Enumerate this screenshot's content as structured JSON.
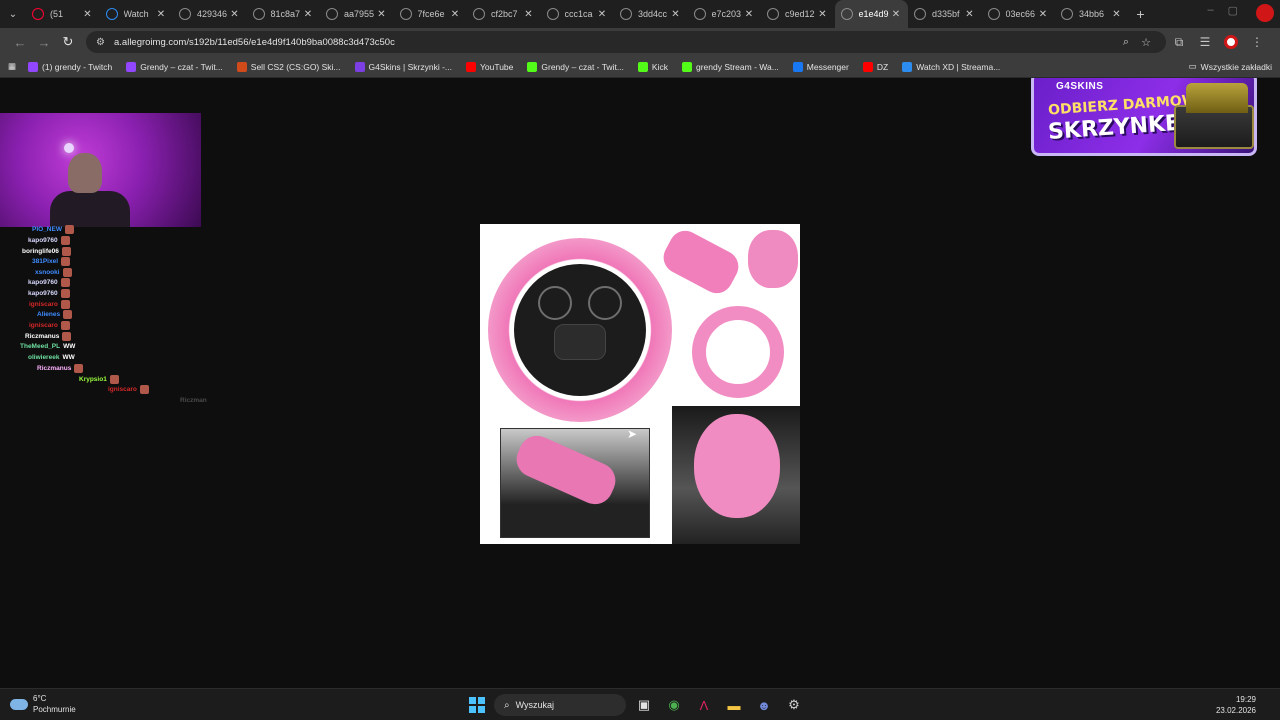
{
  "tabs": [
    {
      "label": "(51",
      "active": false
    },
    {
      "label": "Watch",
      "active": false
    },
    {
      "label": "429346",
      "active": false
    },
    {
      "label": "81c8a7",
      "active": false
    },
    {
      "label": "aa7955",
      "active": false
    },
    {
      "label": "7fce6e",
      "active": false
    },
    {
      "label": "cf2bc7",
      "active": false
    },
    {
      "label": "ccc1ca",
      "active": false
    },
    {
      "label": "3dd4cc",
      "active": false
    },
    {
      "label": "e7c203",
      "active": false
    },
    {
      "label": "c9ed12",
      "active": false
    },
    {
      "label": "e1e4d9",
      "active": true
    },
    {
      "label": "d335bf",
      "active": false
    },
    {
      "label": "03ec66",
      "active": false
    },
    {
      "label": "34bb6",
      "active": false
    }
  ],
  "address": {
    "url": "a.allegroimg.com/s192b/11ed56/e1e4d9f140b9ba0088c3d473c50c"
  },
  "bookmarks": [
    {
      "label": "(1) grendy - Twitch",
      "color": "#9146ff",
      "icon": "twitch-icon"
    },
    {
      "label": "Grendy – czat - Twit...",
      "color": "#9146ff",
      "icon": "twitch-icon"
    },
    {
      "label": "Sell CS2 (CS:GO) Ski...",
      "color": "#d14a1a",
      "icon": "skin-icon"
    },
    {
      "label": "G4Skins | Skrzynki -...",
      "color": "#7b3fe4",
      "icon": "g4skins-icon"
    },
    {
      "label": "YouTube",
      "color": "#ff0000",
      "icon": "youtube-icon"
    },
    {
      "label": "Grendy – czat - Twit...",
      "color": "#53fc18",
      "icon": "kick-icon"
    },
    {
      "label": "Kick",
      "color": "#53fc18",
      "icon": "kick-icon"
    },
    {
      "label": "grendy Stream - Wa...",
      "color": "#53fc18",
      "icon": "kick-icon"
    },
    {
      "label": "Messenger",
      "color": "#1877f2",
      "icon": "facebook-icon"
    },
    {
      "label": "DZ",
      "color": "#ff0000",
      "icon": "youtube-icon"
    },
    {
      "label": "Watch XD | Streama...",
      "color": "#2d8cf0",
      "icon": "watch-icon"
    }
  ],
  "bookmarks_other": "Wszystkie zakładki",
  "chat": [
    {
      "user": "PIO_NEW",
      "color": "#3f8cff",
      "extra": "emote"
    },
    {
      "user": "kapo9760",
      "color": "#d9d9ff",
      "extra": "emote"
    },
    {
      "user": "boringlife06",
      "color": "#ffffff",
      "extra": "emote"
    },
    {
      "user": "381Pixel",
      "color": "#3f8cff",
      "extra": "emote"
    },
    {
      "user": "xsnooki",
      "color": "#3f8cff",
      "extra": "emote"
    },
    {
      "user": "kapo9760",
      "color": "#d9d9ff",
      "extra": "emote"
    },
    {
      "user": "kapo9760",
      "color": "#d9d9ff",
      "extra": "emote"
    },
    {
      "user": "igniscaro",
      "color": "#d62828",
      "extra": "emote"
    },
    {
      "user": "Alienes",
      "color": "#3f8cff",
      "extra": "emote"
    },
    {
      "user": "igniscaro",
      "color": "#d62828",
      "extra": "emote"
    },
    {
      "user": "Riczmanus",
      "color": "#ffffff",
      "extra": "emote"
    },
    {
      "user": "TheMeed_PL",
      "color": "#6fe0a0",
      "extra": "WW"
    },
    {
      "user": "oliwiereek",
      "color": "#6fe0a0",
      "extra": "WW"
    },
    {
      "user": "Riczmanus",
      "color": "#ffb3ff",
      "extra": "emote"
    },
    {
      "user": "Krypsio1",
      "color": "#9bff3f",
      "extra": "emote"
    },
    {
      "user": "igniscaro",
      "color": "#d62828",
      "extra": "emote"
    },
    {
      "user": "Riczman",
      "color": "#4a4a4a",
      "extra": ""
    }
  ],
  "ad": {
    "brand": "G4SKINS",
    "line1": "ODBIERZ DARMOWĄ",
    "line2": "SKRZYNKĘ!"
  },
  "taskbar": {
    "weather_temp": "6°C",
    "weather_desc": "Pochmurnie",
    "search_placeholder": "Wyszukaj",
    "time": "19:29",
    "date": "23.02.2026"
  }
}
